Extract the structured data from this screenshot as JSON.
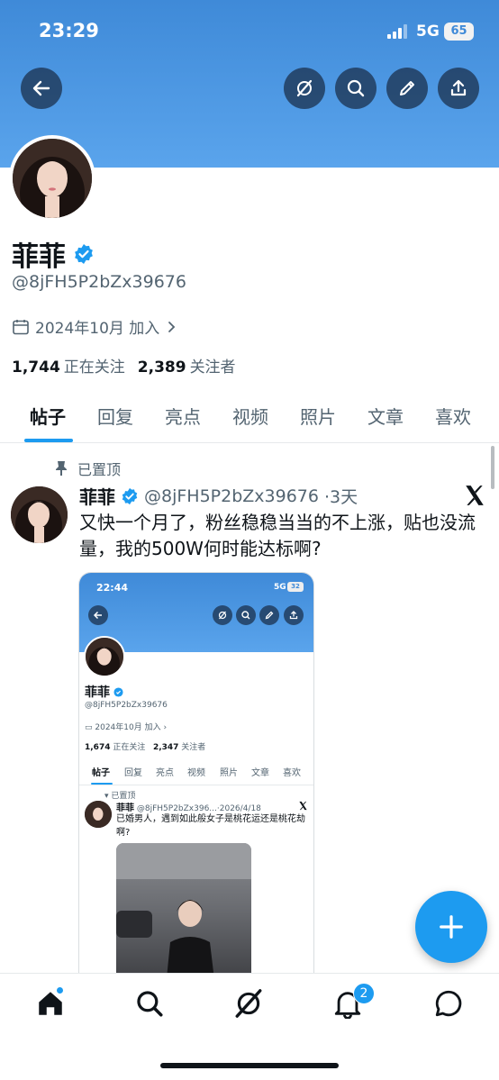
{
  "status_bar": {
    "time": "23:29",
    "network": "5G",
    "battery": "65"
  },
  "header_icons": [
    "back-arrow-icon",
    "grok-icon",
    "search-icon",
    "compose-icon",
    "share-icon"
  ],
  "profile": {
    "name": "菲菲",
    "handle": "@8jFH5P2bZx39676",
    "joined": "2024年10月 加入",
    "following_count": "1,744",
    "following_label": "正在关注",
    "followers_count": "2,389",
    "followers_label": "关注者"
  },
  "tabs": [
    "帖子",
    "回复",
    "亮点",
    "视频",
    "照片",
    "文章",
    "喜欢"
  ],
  "pinned_post": {
    "pinned_label": "已置顶",
    "author": "菲菲",
    "handle": "@8jFH5P2bZx39676",
    "time": "·3天",
    "text": "又快一个月了，粉丝稳稳当当的不上涨，贴也没流量，我的500W何时能达标啊?"
  },
  "embedded_screenshot": {
    "time": "22:44",
    "network": "5G",
    "battery": "32",
    "name": "菲菲",
    "handle": "@8jFH5P2bZx39676",
    "joined": "2024年10月 加入",
    "following_count": "1,674",
    "following_label": "正在关注",
    "followers_count": "2,347",
    "followers_label": "关注者",
    "tabs": [
      "帖子",
      "回复",
      "亮点",
      "视频",
      "照片",
      "文章",
      "喜欢"
    ],
    "pinned_label": "已置顶",
    "post_author": "菲菲",
    "post_meta": "@8jFH5P2bZx396...·2026/4/18",
    "post_text": "已婚男人，遇到如此般女子是桃花运还是桃花劫啊?"
  },
  "bottom_nav": {
    "items": [
      "home-icon",
      "search-icon",
      "grok-icon",
      "notifications-icon",
      "messages-icon"
    ],
    "notifications_badge": "2"
  },
  "colors": {
    "accent": "#1d9bf0",
    "banner": "#4a94e0",
    "text": "#0f1419",
    "muted": "#536471"
  }
}
